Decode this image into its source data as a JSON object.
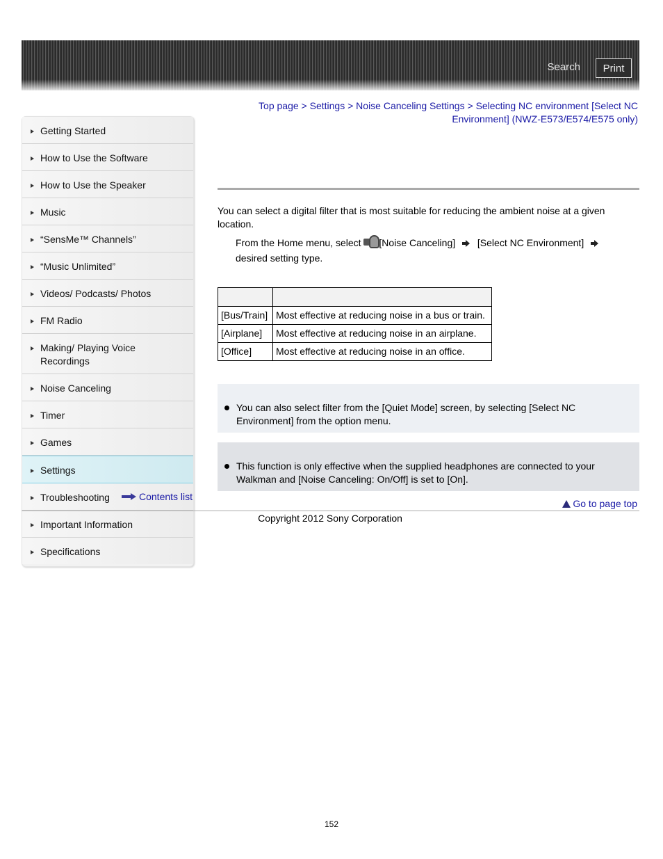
{
  "header": {
    "search_label": "Search",
    "print_label": "Print"
  },
  "sidebar": {
    "items": [
      {
        "label": "Getting Started",
        "active": false
      },
      {
        "label": "How to Use the Software",
        "active": false
      },
      {
        "label": "How to Use the Speaker",
        "active": false
      },
      {
        "label": "Music",
        "active": false
      },
      {
        "label": "“SensMe™ Channels”",
        "active": false
      },
      {
        "label": "“Music Unlimited”",
        "active": false
      },
      {
        "label": "Videos/ Podcasts/ Photos",
        "active": false
      },
      {
        "label": "FM Radio",
        "active": false
      },
      {
        "label": "Making/ Playing Voice Recordings",
        "active": false
      },
      {
        "label": "Noise Canceling",
        "active": false
      },
      {
        "label": "Timer",
        "active": false
      },
      {
        "label": "Games",
        "active": false
      },
      {
        "label": "Settings",
        "active": true
      },
      {
        "label": "Troubleshooting",
        "active": false
      },
      {
        "label": "Important Information",
        "active": false
      },
      {
        "label": "Specifications",
        "active": false
      }
    ],
    "contents_link": "Contents list"
  },
  "breadcrumb": {
    "items": [
      "Top page",
      "Settings",
      "Noise Canceling Settings",
      "Selecting NC environment [Select NC Environment] (NWZ-E573/E574/E575 only)"
    ],
    "separator": ">"
  },
  "main": {
    "intro": "You can select a digital filter that is most suitable for reducing the ambient noise at a given location.",
    "step": {
      "prefix": "From the Home menu, select",
      "item1": "[Noise Canceling]",
      "item2": "[Select NC Environment]",
      "suffix": "desired setting type."
    },
    "table": {
      "header": [
        "",
        ""
      ],
      "rows": [
        [
          "[Bus/Train]",
          "Most effective at reducing noise in a bus or train."
        ],
        [
          "[Airplane]",
          "Most effective at reducing noise in an airplane."
        ],
        [
          "[Office]",
          "Most effective at reducing noise in an office."
        ]
      ]
    },
    "hint": "You can also select filter from the [Quiet Mode] screen, by selecting [Select NC Environment] from the option menu.",
    "note": "This function is only effective when the supplied headphones are connected to your Walkman and [Noise Canceling: On/Off] is set to [On]."
  },
  "footer": {
    "page_top": "Go to page top",
    "copyright": "Copyright 2012 Sony Corporation",
    "page_number": "152"
  }
}
